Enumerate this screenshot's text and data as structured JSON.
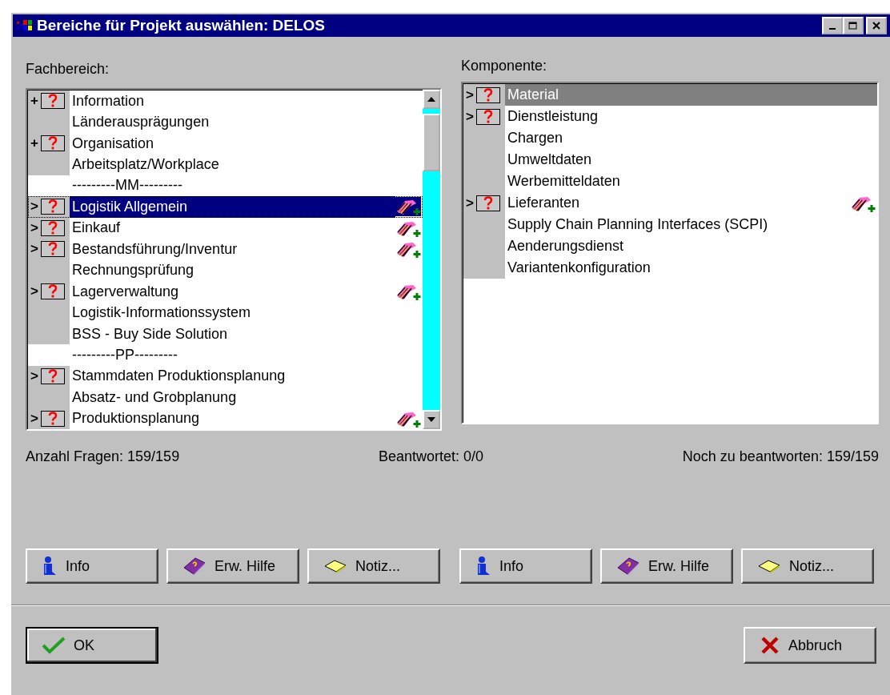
{
  "window": {
    "title": "Bereiche für Projekt auswählen: DELOS"
  },
  "lists": [
    {
      "label": "Fachbereich:",
      "focused": true,
      "scrollable": true,
      "items": [
        {
          "kind": "item",
          "text": "Information",
          "marker": "+",
          "question": true,
          "hand": false,
          "selected": false
        },
        {
          "kind": "item",
          "text": "Länderausprägungen",
          "question": false,
          "hand": false,
          "selected": false
        },
        {
          "kind": "item",
          "text": "Organisation",
          "marker": "+",
          "question": true,
          "hand": false,
          "selected": false
        },
        {
          "kind": "item",
          "text": "Arbeitsplatz/Workplace",
          "question": false,
          "hand": false,
          "selected": false
        },
        {
          "kind": "separator",
          "text": "---------MM---------",
          "selected": false
        },
        {
          "kind": "item",
          "text": "Logistik Allgemein",
          "marker": ">",
          "question": true,
          "hand": true,
          "selected": true
        },
        {
          "kind": "item",
          "text": "Einkauf",
          "marker": ">",
          "question": true,
          "hand": true,
          "selected": false
        },
        {
          "kind": "item",
          "text": "Bestandsführung/Inventur",
          "marker": ">",
          "question": true,
          "hand": true,
          "selected": false
        },
        {
          "kind": "item",
          "text": "Rechnungsprüfung",
          "question": false,
          "hand": false,
          "selected": false
        },
        {
          "kind": "item",
          "text": "Lagerverwaltung",
          "marker": ">",
          "question": true,
          "hand": true,
          "selected": false
        },
        {
          "kind": "item",
          "text": "Logistik-Informationssystem",
          "question": false,
          "hand": false,
          "selected": false
        },
        {
          "kind": "item",
          "text": "BSS - Buy Side Solution",
          "question": false,
          "hand": false,
          "selected": false
        },
        {
          "kind": "separator",
          "text": "---------PP---------",
          "selected": false
        },
        {
          "kind": "item",
          "text": "Stammdaten Produktionsplanung",
          "marker": ">",
          "question": true,
          "hand": false,
          "selected": false
        },
        {
          "kind": "item",
          "text": "Absatz- und Grobplanung",
          "question": false,
          "hand": false,
          "selected": false
        },
        {
          "kind": "item",
          "text": "Produktionsplanung",
          "marker": ">",
          "question": true,
          "hand": true,
          "selected": false
        }
      ]
    },
    {
      "label": "Komponente:",
      "focused": false,
      "scrollable": false,
      "items": [
        {
          "kind": "item",
          "text": "Material",
          "marker": ">",
          "question": true,
          "hand": false,
          "selected": true
        },
        {
          "kind": "item",
          "text": "Dienstleistung",
          "marker": ">",
          "question": true,
          "hand": false,
          "selected": false
        },
        {
          "kind": "item",
          "text": "Chargen",
          "question": false,
          "hand": false,
          "selected": false
        },
        {
          "kind": "item",
          "text": "Umweltdaten",
          "question": false,
          "hand": false,
          "selected": false
        },
        {
          "kind": "item",
          "text": "Werbemitteldaten",
          "question": false,
          "hand": false,
          "selected": false
        },
        {
          "kind": "item",
          "text": "Lieferanten",
          "marker": ">",
          "question": true,
          "hand": true,
          "selected": false
        },
        {
          "kind": "item",
          "text": "Supply Chain Planning Interfaces (SCPI)",
          "question": false,
          "hand": false,
          "selected": false
        },
        {
          "kind": "item",
          "text": "Aenderungsdienst",
          "question": false,
          "hand": false,
          "selected": false
        },
        {
          "kind": "item",
          "text": "Variantenkonfiguration",
          "question": false,
          "hand": false,
          "selected": false
        }
      ]
    }
  ],
  "stats": [
    "Anzahl Fragen: 159/159",
    "Beantwortet: 0/0",
    "Noch zu beantworten: 159/159"
  ],
  "button_groups": [
    [
      {
        "label": "Info",
        "kind": "info"
      },
      {
        "label": "Erw. Hilfe",
        "kind": "help"
      },
      {
        "label": "Notiz...",
        "kind": "note"
      }
    ],
    [
      {
        "label": "Info",
        "kind": "info"
      },
      {
        "label": "Erw. Hilfe",
        "kind": "help"
      },
      {
        "label": "Notiz...",
        "kind": "note"
      }
    ]
  ],
  "footer_buttons": [
    {
      "label": "OK",
      "kind": "ok",
      "default": true
    },
    {
      "label": "Abbruch",
      "kind": "cancel",
      "default": false
    }
  ]
}
